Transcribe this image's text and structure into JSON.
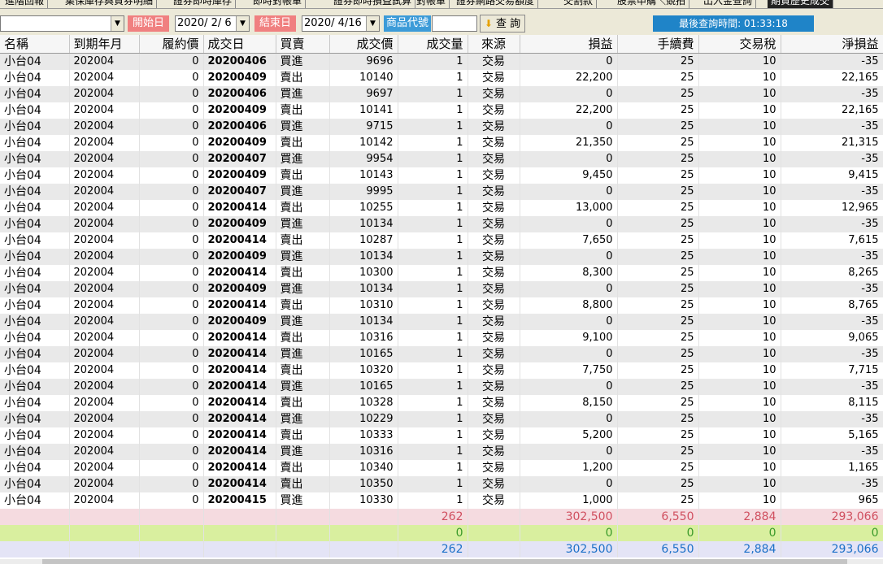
{
  "tabs": [
    "進階回報",
    "集保庫存與資券明細",
    "證券即時庫存",
    "即時對帳單",
    "證券即時損益試算",
    "對帳單",
    "證券網路交易額度",
    "交割款",
    "股票申購＼競拍",
    "出入金查詢",
    "期貨歷史成交"
  ],
  "active_tab": 10,
  "toolbar": {
    "combo_value": "",
    "start_label": "開始日",
    "start_date": "2020/ 2/ 6",
    "end_label": "結束日",
    "end_date": "2020/ 4/16",
    "code_label": "商品代號",
    "code_value": "",
    "query_label": "查 詢",
    "last_query": "最後查詢時間: 01:33:18"
  },
  "columns": [
    "名稱",
    "到期年月",
    "履約價",
    "成交日",
    "買賣",
    "成交價",
    "成交量",
    "來源",
    "損益",
    "手續費",
    "交易稅",
    "淨損益"
  ],
  "rows": [
    [
      "小台04",
      "202004",
      "0",
      "20200406",
      "買進",
      "9696",
      "1",
      "交易",
      "0",
      "25",
      "10",
      "-35"
    ],
    [
      "小台04",
      "202004",
      "0",
      "20200409",
      "賣出",
      "10140",
      "1",
      "交易",
      "22,200",
      "25",
      "10",
      "22,165"
    ],
    [
      "小台04",
      "202004",
      "0",
      "20200406",
      "買進",
      "9697",
      "1",
      "交易",
      "0",
      "25",
      "10",
      "-35"
    ],
    [
      "小台04",
      "202004",
      "0",
      "20200409",
      "賣出",
      "10141",
      "1",
      "交易",
      "22,200",
      "25",
      "10",
      "22,165"
    ],
    [
      "小台04",
      "202004",
      "0",
      "20200406",
      "買進",
      "9715",
      "1",
      "交易",
      "0",
      "25",
      "10",
      "-35"
    ],
    [
      "小台04",
      "202004",
      "0",
      "20200409",
      "賣出",
      "10142",
      "1",
      "交易",
      "21,350",
      "25",
      "10",
      "21,315"
    ],
    [
      "小台04",
      "202004",
      "0",
      "20200407",
      "買進",
      "9954",
      "1",
      "交易",
      "0",
      "25",
      "10",
      "-35"
    ],
    [
      "小台04",
      "202004",
      "0",
      "20200409",
      "賣出",
      "10143",
      "1",
      "交易",
      "9,450",
      "25",
      "10",
      "9,415"
    ],
    [
      "小台04",
      "202004",
      "0",
      "20200407",
      "買進",
      "9995",
      "1",
      "交易",
      "0",
      "25",
      "10",
      "-35"
    ],
    [
      "小台04",
      "202004",
      "0",
      "20200414",
      "賣出",
      "10255",
      "1",
      "交易",
      "13,000",
      "25",
      "10",
      "12,965"
    ],
    [
      "小台04",
      "202004",
      "0",
      "20200409",
      "買進",
      "10134",
      "1",
      "交易",
      "0",
      "25",
      "10",
      "-35"
    ],
    [
      "小台04",
      "202004",
      "0",
      "20200414",
      "賣出",
      "10287",
      "1",
      "交易",
      "7,650",
      "25",
      "10",
      "7,615"
    ],
    [
      "小台04",
      "202004",
      "0",
      "20200409",
      "買進",
      "10134",
      "1",
      "交易",
      "0",
      "25",
      "10",
      "-35"
    ],
    [
      "小台04",
      "202004",
      "0",
      "20200414",
      "賣出",
      "10300",
      "1",
      "交易",
      "8,300",
      "25",
      "10",
      "8,265"
    ],
    [
      "小台04",
      "202004",
      "0",
      "20200409",
      "買進",
      "10134",
      "1",
      "交易",
      "0",
      "25",
      "10",
      "-35"
    ],
    [
      "小台04",
      "202004",
      "0",
      "20200414",
      "賣出",
      "10310",
      "1",
      "交易",
      "8,800",
      "25",
      "10",
      "8,765"
    ],
    [
      "小台04",
      "202004",
      "0",
      "20200409",
      "買進",
      "10134",
      "1",
      "交易",
      "0",
      "25",
      "10",
      "-35"
    ],
    [
      "小台04",
      "202004",
      "0",
      "20200414",
      "賣出",
      "10316",
      "1",
      "交易",
      "9,100",
      "25",
      "10",
      "9,065"
    ],
    [
      "小台04",
      "202004",
      "0",
      "20200414",
      "買進",
      "10165",
      "1",
      "交易",
      "0",
      "25",
      "10",
      "-35"
    ],
    [
      "小台04",
      "202004",
      "0",
      "20200414",
      "賣出",
      "10320",
      "1",
      "交易",
      "7,750",
      "25",
      "10",
      "7,715"
    ],
    [
      "小台04",
      "202004",
      "0",
      "20200414",
      "買進",
      "10165",
      "1",
      "交易",
      "0",
      "25",
      "10",
      "-35"
    ],
    [
      "小台04",
      "202004",
      "0",
      "20200414",
      "賣出",
      "10328",
      "1",
      "交易",
      "8,150",
      "25",
      "10",
      "8,115"
    ],
    [
      "小台04",
      "202004",
      "0",
      "20200414",
      "買進",
      "10229",
      "1",
      "交易",
      "0",
      "25",
      "10",
      "-35"
    ],
    [
      "小台04",
      "202004",
      "0",
      "20200414",
      "賣出",
      "10333",
      "1",
      "交易",
      "5,200",
      "25",
      "10",
      "5,165"
    ],
    [
      "小台04",
      "202004",
      "0",
      "20200414",
      "買進",
      "10316",
      "1",
      "交易",
      "0",
      "25",
      "10",
      "-35"
    ],
    [
      "小台04",
      "202004",
      "0",
      "20200414",
      "賣出",
      "10340",
      "1",
      "交易",
      "1,200",
      "25",
      "10",
      "1,165"
    ],
    [
      "小台04",
      "202004",
      "0",
      "20200414",
      "賣出",
      "10350",
      "1",
      "交易",
      "0",
      "25",
      "10",
      "-35"
    ],
    [
      "小台04",
      "202004",
      "0",
      "20200415",
      "買進",
      "10330",
      "1",
      "交易",
      "1,000",
      "25",
      "10",
      "965"
    ]
  ],
  "summary": [
    {
      "qty": "262",
      "pnl": "302,500",
      "fee": "6,550",
      "tax": "2,884",
      "net": "293,066"
    },
    {
      "qty": "0",
      "pnl": "0",
      "fee": "0",
      "tax": "0",
      "net": "0"
    },
    {
      "qty": "262",
      "pnl": "302,500",
      "fee": "6,550",
      "tax": "2,884",
      "net": "293,066"
    }
  ],
  "colors": {
    "start_label_bg": "#f08080",
    "code_label_bg": "#3c9bd8",
    "last_query_bg": "#1f84c8",
    "summary1_text": "#d05060",
    "summary2_text": "#3a9a2a",
    "summary3_text": "#1c70c8"
  }
}
